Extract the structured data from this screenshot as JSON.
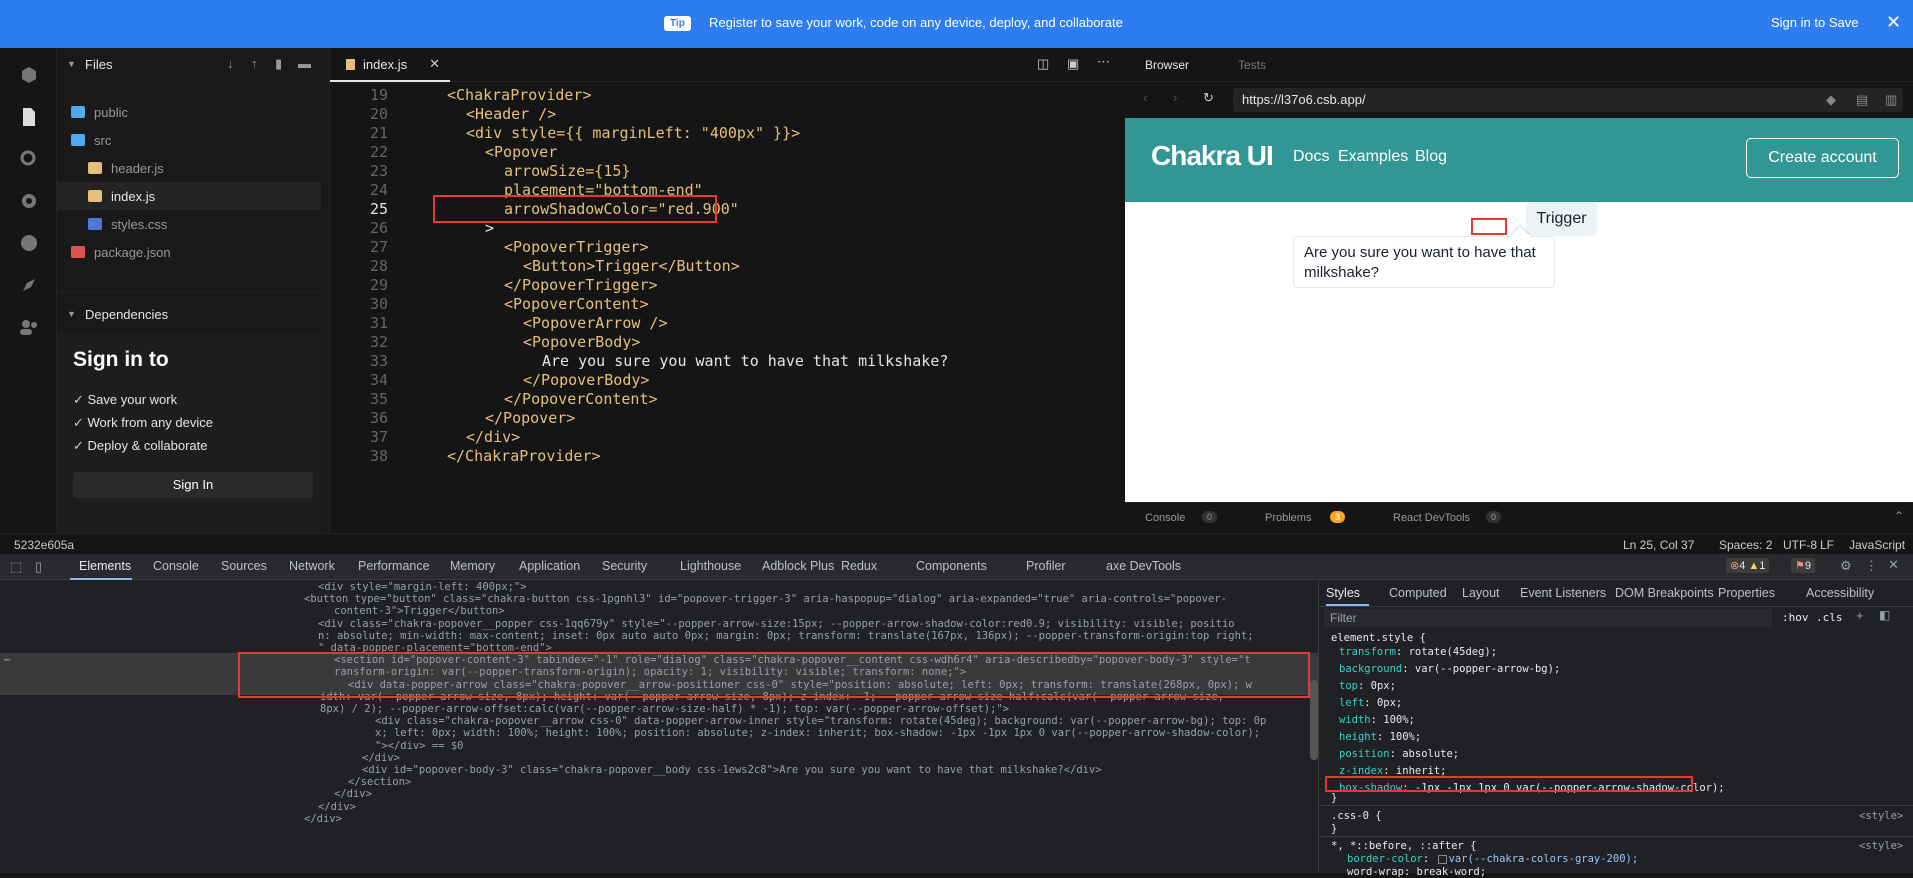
{
  "banner": {
    "tip": "Tip",
    "message": "Register to save your work, code on any device, deploy, and collaborate",
    "sign_in": "Sign in to Save"
  },
  "sidebar": {
    "files_title": "Files",
    "items": [
      {
        "label": "public",
        "icon": "folder-icon"
      },
      {
        "label": "src",
        "icon": "folder-open-icon"
      },
      {
        "label": "header.js",
        "icon": "js-file-icon"
      },
      {
        "label": "index.js",
        "icon": "js-file-icon"
      },
      {
        "label": "styles.css",
        "icon": "css-file-icon"
      },
      {
        "label": "package.json",
        "icon": "json-file-icon"
      }
    ],
    "dependencies_title": "Dependencies",
    "sign_in_title": "Sign in to",
    "benefits": [
      "Save your work",
      "Work from any device",
      "Deploy & collaborate"
    ],
    "sign_in_button": "Sign In"
  },
  "editor": {
    "tab": "index.js",
    "lines": [
      {
        "n": "19",
        "code": "<ChakraProvider>"
      },
      {
        "n": "20",
        "code": "<Header />"
      },
      {
        "n": "21",
        "code": "<div style={{ marginLeft: \"400px\" }}>"
      },
      {
        "n": "22",
        "code": "<Popover"
      },
      {
        "n": "23",
        "code": "arrowSize={15}"
      },
      {
        "n": "24",
        "code": "placement=\"bottom-end\""
      },
      {
        "n": "25",
        "code": "arrowShadowColor=\"red.900\""
      },
      {
        "n": "26",
        "code": ">"
      },
      {
        "n": "27",
        "code": "<PopoverTrigger>"
      },
      {
        "n": "28",
        "code": "<Button>Trigger</Button>"
      },
      {
        "n": "29",
        "code": "</PopoverTrigger>"
      },
      {
        "n": "30",
        "code": "<PopoverContent>"
      },
      {
        "n": "31",
        "code": "<PopoverArrow />"
      },
      {
        "n": "32",
        "code": "<PopoverBody>"
      },
      {
        "n": "33",
        "code": "Are you sure you want to have that milkshake?"
      },
      {
        "n": "34",
        "code": "</PopoverBody>"
      },
      {
        "n": "35",
        "code": "</PopoverContent>"
      },
      {
        "n": "36",
        "code": "</Popover>"
      },
      {
        "n": "37",
        "code": "</div>"
      },
      {
        "n": "38",
        "code": "</ChakraProvider>"
      }
    ]
  },
  "browser": {
    "tab_browser": "Browser",
    "tab_tests": "Tests",
    "url": "https://l37o6.csb.app/",
    "site": {
      "logo": "Chakra UI",
      "nav": [
        "Docs",
        "Examples",
        "Blog"
      ],
      "create_account": "Create account",
      "trigger": "Trigger",
      "popover_text": "Are you sure you want to have that milkshake?"
    },
    "footer": {
      "console": "Console",
      "console_count": "0",
      "problems": "Problems",
      "problems_count": "3",
      "devtools": "React DevTools",
      "devtools_count": "0"
    }
  },
  "statusbar": {
    "hash": "5232e605a",
    "position": "Ln 25, Col 37",
    "spaces": "Spaces: 2",
    "encoding": "UTF-8",
    "eol": "LF",
    "language": "JavaScript"
  },
  "devtools": {
    "tabs": [
      "Elements",
      "Console",
      "Sources",
      "Network",
      "Performance",
      "Memory",
      "Application",
      "Security",
      "Lighthouse",
      "Adblock Plus",
      "Redux",
      "Components",
      "Profiler",
      "axe DevTools"
    ],
    "errors": "4",
    "warnings": "1",
    "issues": "9",
    "elements_lines": [
      "<div style=\"margin-left: 400px;\">",
      "<button type=\"button\" class=\"chakra-button css-1pgnhl3\" id=\"popover-trigger-3\" aria-haspopup=\"dialog\" aria-expanded=\"true\" aria-controls=\"popover-",
      "content-3\">Trigger</button>",
      "<div class=\"chakra-popover__popper css-1qq679y\" style=\"--popper-arrow-size:15px; --popper-arrow-shadow-color:red0.9; visibility: visible; positio",
      "n: absolute; min-width: max-content; inset: 0px auto auto 0px; margin: 0px; transform: translate(167px, 136px); --popper-transform-origin:top right;",
      "\" data-popper-placement=\"bottom-end\">",
      "<section id=\"popover-content-3\" tabindex=\"-1\" role=\"dialog\" class=\"chakra-popover__content css-wdh6r4\" aria-describedby=\"popover-body-3\" style=\"t",
      "ransform-origin: var(--popper-transform-origin); opacity: 1; visibility: visible; transform: none;\">",
      "<div data-popper-arrow class=\"chakra-popover__arrow-positioner css-0\" style=\"position: absolute; left: 0px; transform: translate(268px, 0px); w",
      "idth: var(--popper-arrow-size, 8px); height: var(--popper-arrow-size, 8px); z-index: -1; --popper-arrow-size-half:calc(var(--popper-arrow-size,",
      "8px) / 2); --popper-arrow-offset:calc(var(--popper-arrow-size-half) * -1); top: var(--popper-arrow-offset);\">",
      "<div class=\"chakra-popover__arrow css-0\" data-popper-arrow-inner style=\"transform: rotate(45deg); background: var(--popper-arrow-bg); top: 0p",
      "x; left: 0px; width: 100%; height: 100%; position: absolute; z-index: inherit; box-shadow: -1px -1px 1px 0 var(--popper-arrow-shadow-color);",
      "\"></div> == $0",
      "</div>",
      "<div id=\"popover-body-3\" class=\"chakra-popover__body css-1ews2c8\">Are you sure you want to have that milkshake?</div>",
      "</section>",
      "</div>",
      "</div>",
      "</div>"
    ],
    "styles_tabs": [
      "Styles",
      "Computed",
      "Layout",
      "Event Listeners",
      "DOM Breakpoints",
      "Properties",
      "Accessibility"
    ],
    "filter_placeholder": "Filter",
    "hov": ":hov",
    "cls": ".cls",
    "selector_element": "element.style {",
    "rules": [
      {
        "prop": "transform",
        "value": "rotate(45deg);"
      },
      {
        "prop": "background",
        "value": "var(--popper-arrow-bg);"
      },
      {
        "prop": "top",
        "value": "0px;"
      },
      {
        "prop": "left",
        "value": "0px;"
      },
      {
        "prop": "width",
        "value": "100%;"
      },
      {
        "prop": "height",
        "value": "100%;"
      },
      {
        "prop": "position",
        "value": "absolute;"
      },
      {
        "prop": "z-index",
        "value": "inherit;"
      },
      {
        "prop": "box-shadow",
        "value": "-1px -1px 1px 0 var(--popper-arrow-shadow-color);"
      }
    ],
    "close_brace": "}",
    "css0": ".css-0 {",
    "style_src": "<style>",
    "universal": "*, *::before, ::after {",
    "border_color": "border-color",
    "border_color_val": "var(--chakra-colors-gray-200);",
    "word_wrap": "word-wrap: break-word;"
  }
}
